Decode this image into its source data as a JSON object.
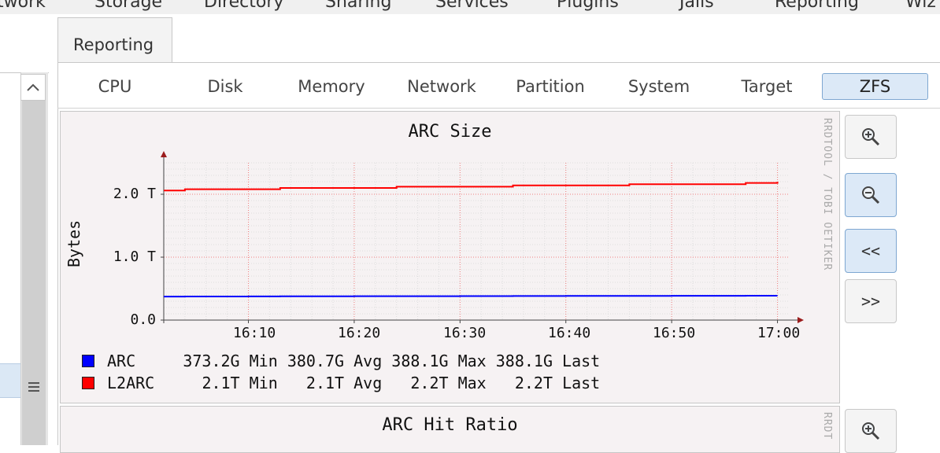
{
  "topnav": {
    "items": [
      "twork",
      "Storage",
      "Directory",
      "Sharing",
      "Services",
      "Plugins",
      "Jails",
      "Reporting",
      "Wiz"
    ]
  },
  "tab": {
    "label": "Reporting"
  },
  "subtabs": [
    "CPU",
    "Disk",
    "Memory",
    "Network",
    "Partition",
    "System",
    "Target",
    "ZFS"
  ],
  "active_subtab": "ZFS",
  "graph1": {
    "title": "ARC Size",
    "watermark": "RRDTOOL / TOBI OETIKER",
    "ylabel": "Bytes",
    "yticks": [
      "0.0",
      "1.0 T",
      "2.0 T"
    ],
    "xticks": [
      "16:10",
      "16:20",
      "16:30",
      "16:40",
      "16:50",
      "17:00"
    ],
    "legend": [
      {
        "name": "ARC",
        "min": "373.2G",
        "avg": "380.7G",
        "max": "388.1G",
        "last": "388.1G",
        "color": "#0000ff"
      },
      {
        "name": "L2ARC",
        "min": "2.1T",
        "avg": "2.1T",
        "max": "2.2T",
        "last": "2.2T",
        "color": "#ff0000"
      }
    ],
    "labels": {
      "min": "Min",
      "avg": "Avg",
      "max": "Max",
      "last": "Last"
    }
  },
  "graph2": {
    "title": "ARC Hit Ratio",
    "watermark": "RRDT"
  },
  "buttons": {
    "zoom_in_icon": "zoom-in-icon",
    "zoom_out_icon": "zoom-out-icon",
    "back_label": "<<",
    "forward_label": ">>"
  },
  "chart_data": {
    "type": "line",
    "title": "ARC Size",
    "xlabel": "",
    "ylabel": "Bytes",
    "x": [
      "16:02",
      "16:04",
      "16:10",
      "16:13",
      "16:20",
      "16:24",
      "16:30",
      "16:35",
      "16:40",
      "16:46",
      "16:50",
      "16:57",
      "17:00"
    ],
    "series": [
      {
        "name": "ARC",
        "color": "#0000ff",
        "unit": "TB",
        "values": [
          0.373,
          0.375,
          0.376,
          0.378,
          0.379,
          0.38,
          0.381,
          0.383,
          0.384,
          0.385,
          0.386,
          0.388,
          0.388
        ]
      },
      {
        "name": "L2ARC",
        "color": "#ff0000",
        "unit": "TB",
        "values": [
          2.06,
          2.08,
          2.08,
          2.1,
          2.1,
          2.12,
          2.12,
          2.14,
          2.14,
          2.16,
          2.16,
          2.18,
          2.2
        ]
      }
    ],
    "ylim": [
      0,
      2.5
    ],
    "xlim": [
      "16:02",
      "17:01"
    ],
    "grid": true
  }
}
